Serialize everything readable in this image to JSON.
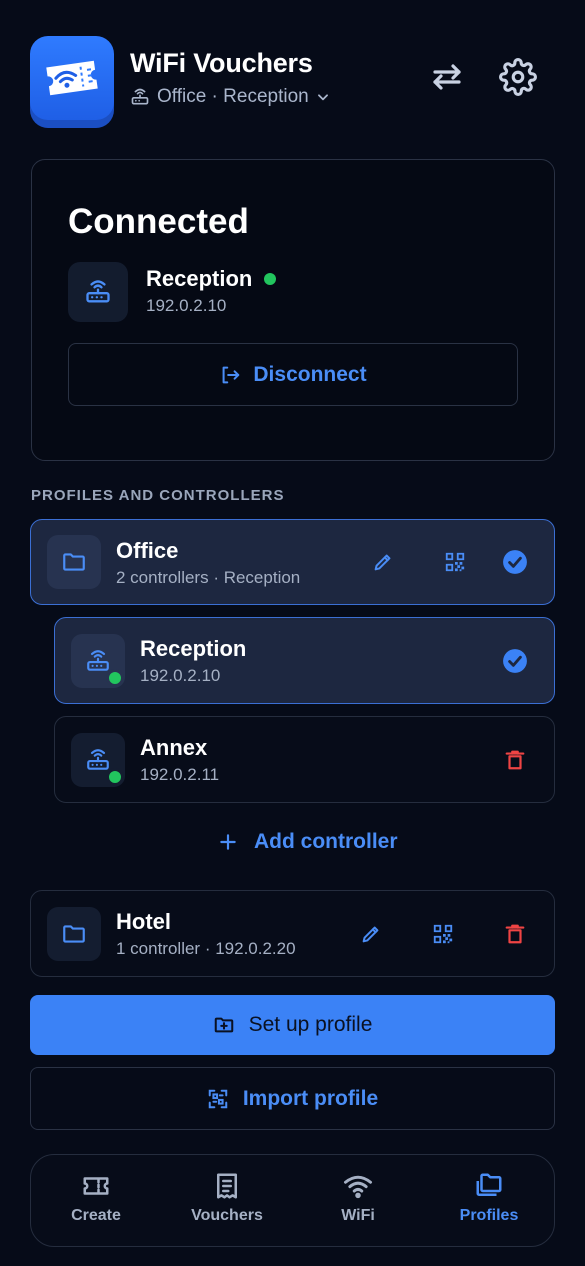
{
  "header": {
    "title": "WiFi Vouchers",
    "subtitle": "Office · Reception"
  },
  "connection": {
    "status": "Connected",
    "controller_name": "Reception",
    "controller_ip": "192.0.2.10",
    "disconnect_label": "Disconnect"
  },
  "section_label": "PROFILES AND CONTROLLERS",
  "profiles": [
    {
      "name": "Office",
      "subtitle": "2 controllers · Reception",
      "controllers": [
        {
          "name": "Reception",
          "ip": "192.0.2.10"
        },
        {
          "name": "Annex",
          "ip": "192.0.2.11"
        }
      ],
      "add_controller_label": "Add controller"
    },
    {
      "name": "Hotel",
      "subtitle": "1 controller · 192.0.2.20"
    }
  ],
  "actions": {
    "setup_label": "Set up profile",
    "import_label": "Import profile"
  },
  "nav": [
    {
      "label": "Create",
      "icon": "ticket-icon"
    },
    {
      "label": "Vouchers",
      "icon": "receipt-icon"
    },
    {
      "label": "WiFi",
      "icon": "wifi-icon"
    },
    {
      "label": "Profiles",
      "icon": "folders-icon"
    }
  ],
  "colors": {
    "accent": "#3b82f6",
    "online": "#22c55e",
    "danger": "#ef4444",
    "background": "#060b18"
  }
}
